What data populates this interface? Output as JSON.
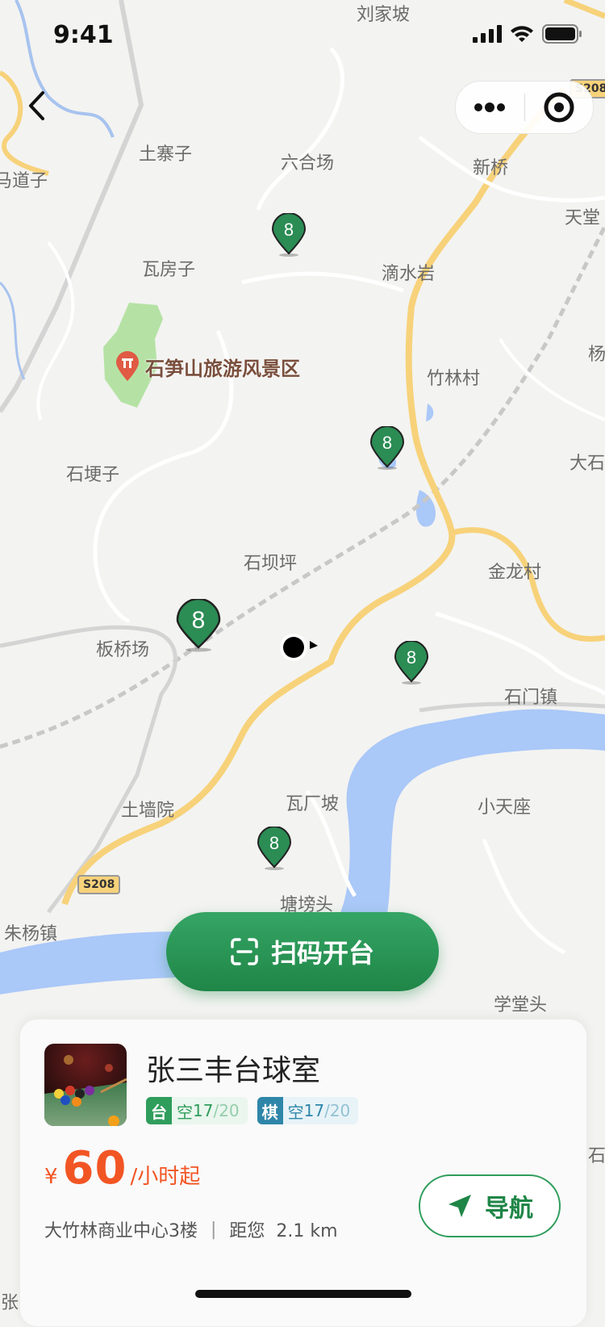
{
  "status_bar": {
    "time": "9:41",
    "icons": [
      "signal-icon",
      "wifi-icon",
      "battery-icon"
    ]
  },
  "nav": {
    "back_icon": "chevron-left-icon",
    "capsule_icons": [
      "more-icon",
      "target-icon"
    ]
  },
  "map": {
    "labels": [
      "刘家坡",
      "土寨子",
      "六合场",
      "新桥",
      "马道子",
      "瓦房子",
      "滴水岩",
      "天堂",
      "竹林村",
      "杨",
      "石埂子",
      "大石",
      "石坝坪",
      "金龙村",
      "板桥场",
      "石门镇",
      "土墙院",
      "瓦厂坡",
      "小天座",
      "朱杨镇",
      "塘塝头",
      "学堂头",
      "石",
      "张"
    ],
    "road_shields": [
      "S208",
      "S208"
    ],
    "scenic": {
      "label": "石笋山旅游风景区",
      "icon": "scenic-spot-icon"
    },
    "markers": [
      "8",
      "8",
      "8",
      "8",
      "8"
    ],
    "user_location_icon": "user-location-icon"
  },
  "scan_button": {
    "label": "扫码开台",
    "icon": "scan-icon"
  },
  "venue": {
    "name": "张三丰台球室",
    "thumbnail": "billiards-photo",
    "badges": [
      {
        "tag": "台",
        "label": "空",
        "available": "17",
        "total": "/20"
      },
      {
        "tag": "棋",
        "label": "空",
        "available": "17",
        "total": "/20"
      }
    ],
    "price": {
      "currency": "¥",
      "amount": "60",
      "unit": "/小时起"
    },
    "address": "大竹林商业中心3楼",
    "separator": "|",
    "distance": "距您  2.1 km",
    "nav_button": {
      "label": "导航",
      "icon": "navigation-arrow-icon"
    }
  },
  "colors": {
    "brand_green": "#1f8647",
    "price_orange": "#f25524",
    "water": "#aac8f8",
    "road_yellow": "#f7d27a"
  }
}
